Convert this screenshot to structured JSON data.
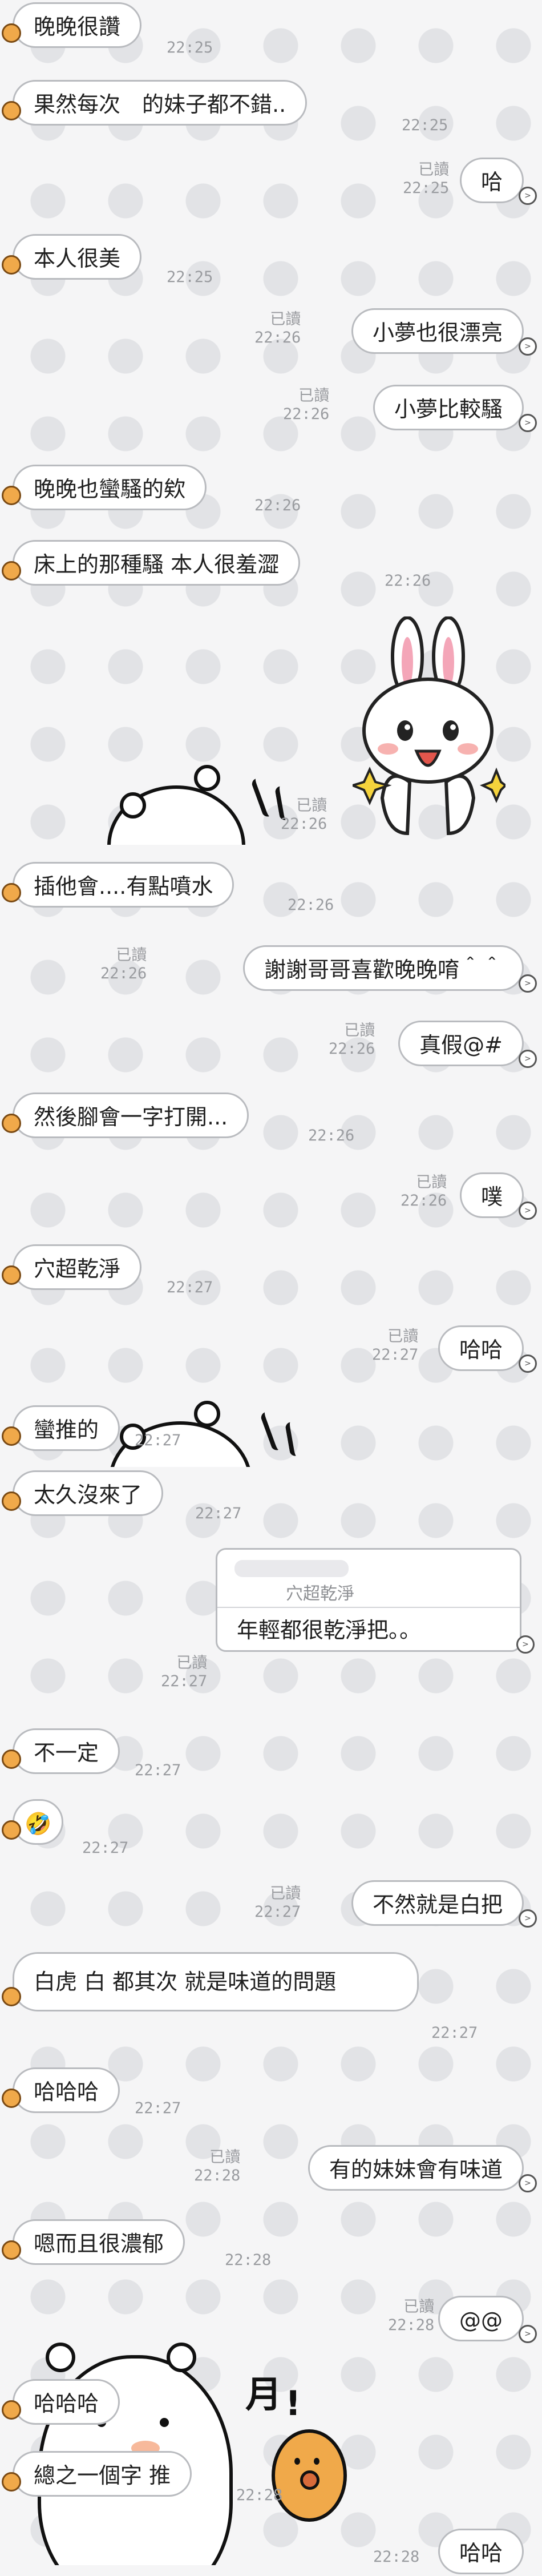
{
  "chat": {
    "read_label": "已讀",
    "messages": [
      {
        "id": "m1",
        "dir": "in",
        "text": "晚晚很讚",
        "time": "22:25"
      },
      {
        "id": "m2",
        "dir": "in",
        "text": "果然每次　的妹子都不錯..",
        "time": "22:25"
      },
      {
        "id": "m3",
        "dir": "out",
        "text": "哈",
        "time": "22:25",
        "read": true
      },
      {
        "id": "m4",
        "dir": "in",
        "text": "本人很美",
        "time": "22:25"
      },
      {
        "id": "m5",
        "dir": "out",
        "text": "小夢也很漂亮",
        "time": "22:26",
        "read": true
      },
      {
        "id": "m6",
        "dir": "out",
        "text": "小夢比較騷",
        "time": "22:26",
        "read": true
      },
      {
        "id": "m7",
        "dir": "in",
        "text": "晚晚也蠻騷的欸",
        "time": "22:26"
      },
      {
        "id": "m8",
        "dir": "in",
        "text": "床上的那種騷 本人很羞澀",
        "time": "22:26"
      },
      {
        "id": "m9",
        "dir": "out",
        "type": "sticker",
        "sticker": "cony-rabbit-sticker",
        "time": "22:26",
        "read": true
      },
      {
        "id": "m10",
        "dir": "in",
        "text": "插他會....有點噴水",
        "time": "22:26"
      },
      {
        "id": "m11",
        "dir": "out",
        "text": "謝謝哥哥喜歡晚晚唷＾＾",
        "time": "22:26",
        "read": true
      },
      {
        "id": "m12",
        "dir": "out",
        "text": "真假@#",
        "time": "22:26",
        "read": true
      },
      {
        "id": "m13",
        "dir": "in",
        "text": "然後腳會一字打開...",
        "time": "22:26"
      },
      {
        "id": "m14",
        "dir": "out",
        "text": "噗",
        "time": "22:26",
        "read": true
      },
      {
        "id": "m15",
        "dir": "in",
        "text": "穴超乾淨",
        "time": "22:27"
      },
      {
        "id": "m16",
        "dir": "out",
        "text": "哈哈",
        "time": "22:27",
        "read": true
      },
      {
        "id": "m17",
        "dir": "in",
        "text": "蠻推的",
        "time": "22:27"
      },
      {
        "id": "m18",
        "dir": "in",
        "text": "太久沒來了",
        "time": "22:27"
      },
      {
        "id": "m19",
        "dir": "out",
        "type": "reply",
        "quoted": "穴超乾淨",
        "text": "年輕都很乾淨把。。",
        "time": "22:27",
        "read": true
      },
      {
        "id": "m20",
        "dir": "in",
        "text": "不一定",
        "time": "22:27"
      },
      {
        "id": "m21",
        "dir": "in",
        "text": "🤣",
        "time": "22:27"
      },
      {
        "id": "m22",
        "dir": "out",
        "text": "不然就是白把",
        "time": "22:27",
        "read": true
      },
      {
        "id": "m23",
        "dir": "in",
        "text": "白虎 白 都其次 就是味道的問題",
        "time": "22:27"
      },
      {
        "id": "m24",
        "dir": "in",
        "text": "哈哈哈",
        "time": "22:27"
      },
      {
        "id": "m25",
        "dir": "out",
        "text": "有的妹妹會有味道",
        "time": "22:28",
        "read": true
      },
      {
        "id": "m26",
        "dir": "in",
        "text": "嗯而且很濃郁",
        "time": "22:28"
      },
      {
        "id": "m27",
        "dir": "out",
        "text": "@@",
        "time": "22:28",
        "read": true
      },
      {
        "id": "m28",
        "dir": "in",
        "text": "哈哈哈",
        "time": "22:28"
      },
      {
        "id": "m29",
        "dir": "in",
        "text": "總之一個字 推",
        "time": "22:28"
      },
      {
        "id": "m30",
        "dir": "out",
        "text": "哈哈",
        "time": "22:28",
        "read": true
      }
    ]
  },
  "colors": {
    "background": "#f5f5f6",
    "polka_dot": "#e2e3e6",
    "bubble_fill": "#ffffff",
    "bubble_border": "#b9bbbf",
    "meta_text": "#9a9ca0",
    "avatar_orange": "#f0a94a"
  }
}
